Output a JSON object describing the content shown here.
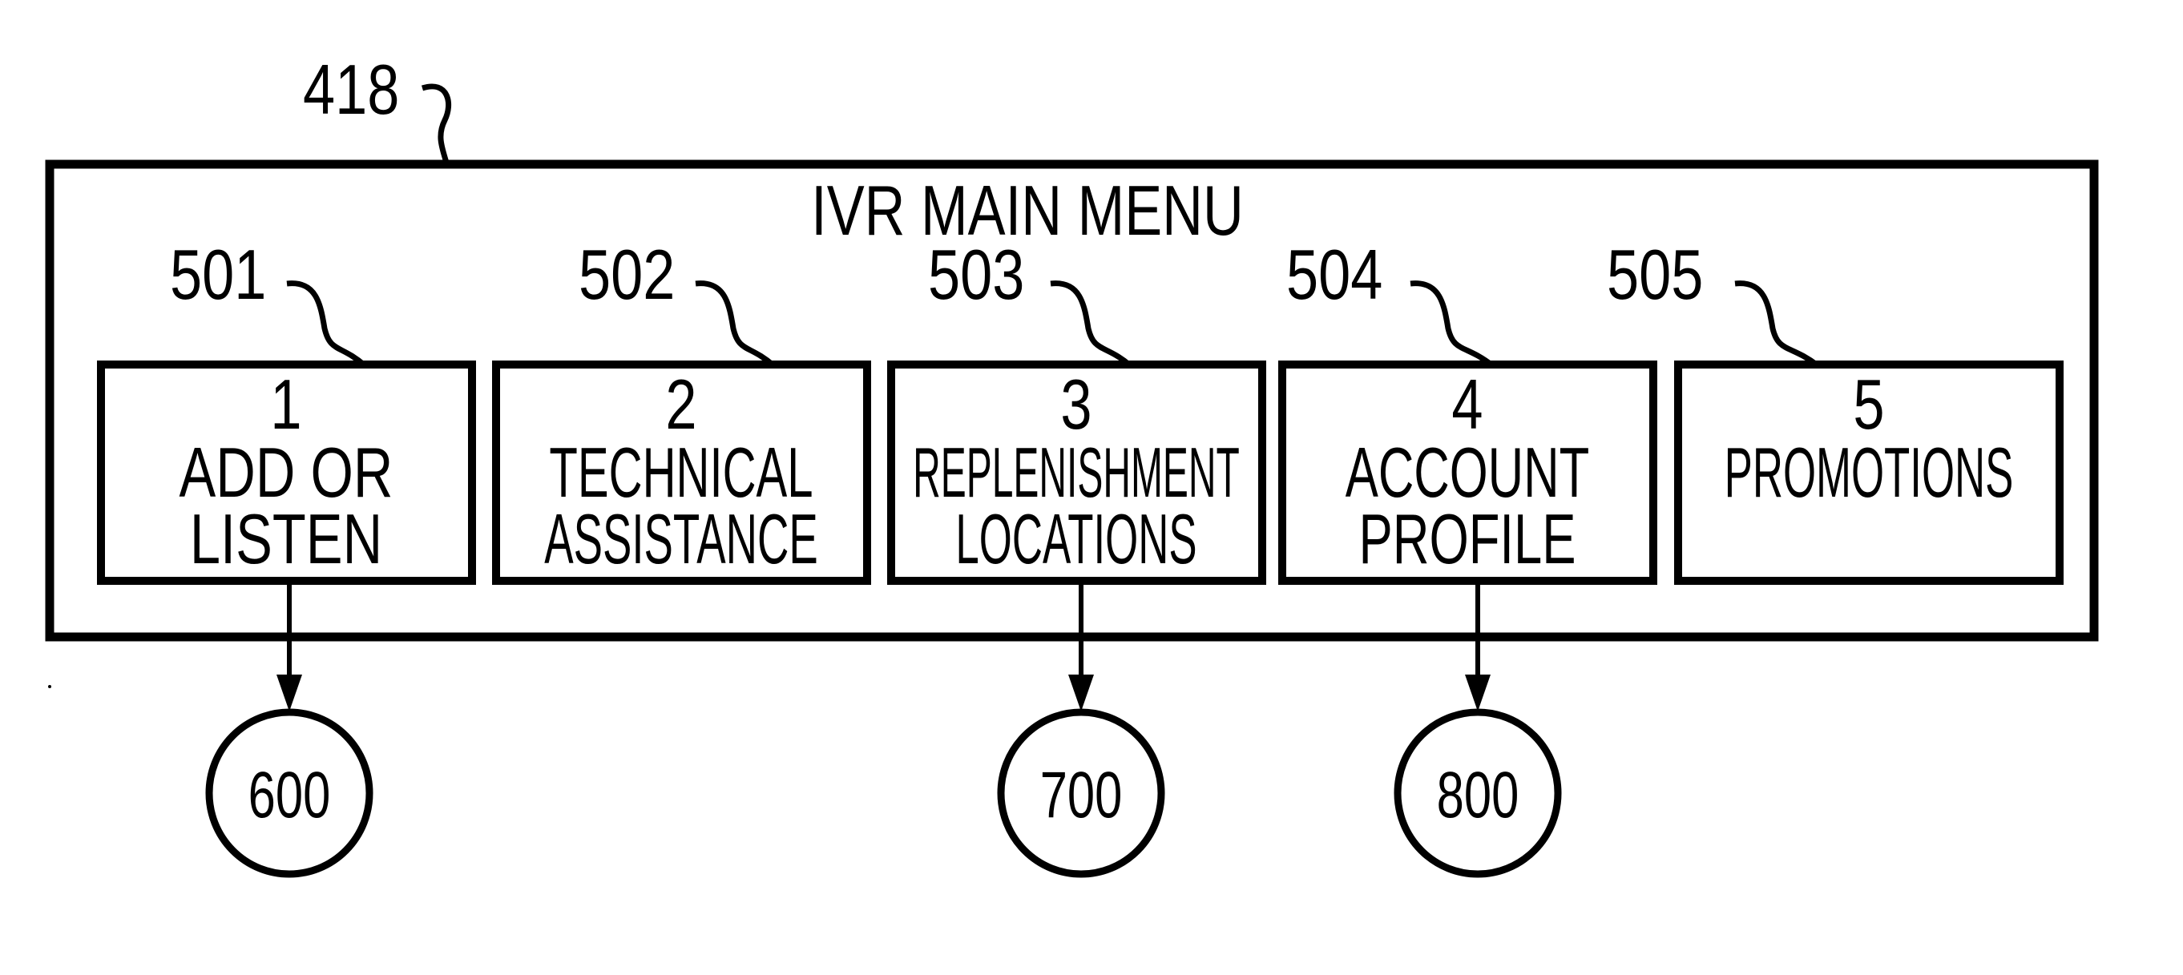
{
  "diagram": {
    "container": {
      "ref": "418",
      "title": "IVR MAIN MENU"
    },
    "menu_options": [
      {
        "ref": "501",
        "key": "1",
        "lines": [
          "ADD OR",
          "LISTEN"
        ],
        "target": "600"
      },
      {
        "ref": "502",
        "key": "2",
        "lines": [
          "TECHNICAL",
          "ASSISTANCE"
        ],
        "target": null
      },
      {
        "ref": "503",
        "key": "3",
        "lines": [
          "REPLENISHMENT",
          "LOCATIONS"
        ],
        "target": "700"
      },
      {
        "ref": "504",
        "key": "4",
        "lines": [
          "ACCOUNT",
          "PROFILE"
        ],
        "target": "800"
      },
      {
        "ref": "505",
        "key": "5",
        "lines": [
          "PROMOTIONS"
        ],
        "target": null
      }
    ],
    "connectors": [
      {
        "label": "600"
      },
      {
        "label": "700"
      },
      {
        "label": "800"
      }
    ]
  }
}
